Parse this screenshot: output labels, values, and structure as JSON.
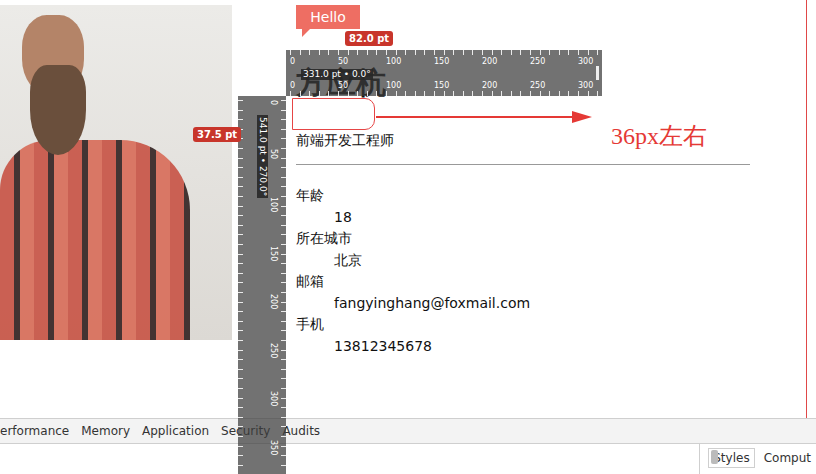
{
  "annotation": {
    "bubble": "Hello",
    "badges": [
      "82.0 pt",
      "37.5 pt"
    ],
    "note": "36px左右"
  },
  "rulers": {
    "horizontal": {
      "readout": "331.0 pt • 0.0°",
      "ticks": [
        "0",
        "50",
        "100",
        "150",
        "200",
        "250",
        "300"
      ]
    },
    "vertical": {
      "readout": "541.0 pt • 270.0°",
      "ticks": [
        "0",
        "50",
        "100",
        "150",
        "200",
        "250",
        "300",
        "350"
      ]
    }
  },
  "resume": {
    "name": "方应杭",
    "title": "前端开发工程师",
    "fields": [
      {
        "label": "年龄",
        "value": "18"
      },
      {
        "label": "所在城市",
        "value": "北京"
      },
      {
        "label": "邮箱",
        "value": "fangyinghang@foxmail.com"
      },
      {
        "label": "手机",
        "value": "13812345678"
      }
    ]
  },
  "devtools": {
    "tabs": [
      {
        "label": "erformance",
        "selected": false
      },
      {
        "label": "Memory",
        "selected": false
      },
      {
        "label": "Application",
        "selected": false
      },
      {
        "label": "Security",
        "selected": false
      },
      {
        "label": "Audits",
        "selected": false
      }
    ],
    "side_tabs": [
      {
        "label": "Styles",
        "selected": true
      },
      {
        "label": "Comput",
        "selected": false
      }
    ]
  }
}
